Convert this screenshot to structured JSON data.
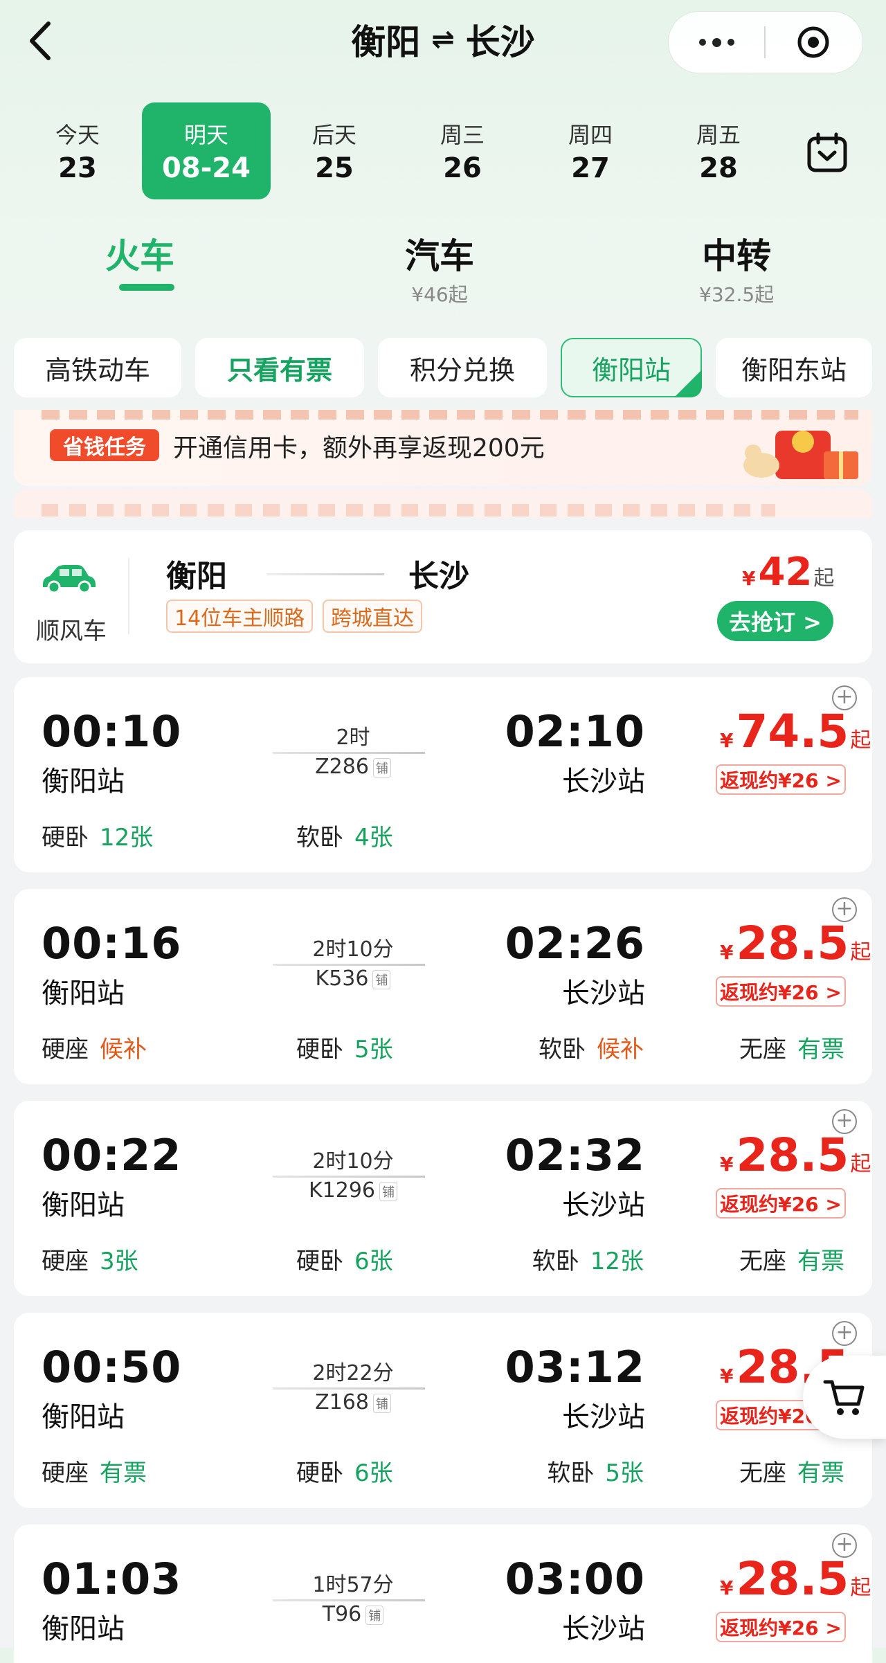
{
  "header": {
    "from_city": "衡阳",
    "swap_icon": "⇌",
    "to_city": "长沙"
  },
  "dates": [
    {
      "week": "今天",
      "day": "23"
    },
    {
      "week": "明天",
      "day": "08-24"
    },
    {
      "week": "后天",
      "day": "25"
    },
    {
      "week": "周三",
      "day": "26"
    },
    {
      "week": "周四",
      "day": "27"
    },
    {
      "week": "周五",
      "day": "28"
    }
  ],
  "modes": [
    {
      "label": "火车",
      "sub": ""
    },
    {
      "label": "汽车",
      "sub": "¥46起"
    },
    {
      "label": "中转",
      "sub": "¥32.5起"
    }
  ],
  "filters": [
    "高铁动车",
    "只看有票",
    "积分兑换",
    "衡阳站",
    "衡阳东站"
  ],
  "promo": {
    "badge": "省钱任务",
    "text": "开通信用卡，额外再享返现200元"
  },
  "carpool": {
    "label": "顺风车",
    "from": "衡阳",
    "to": "长沙",
    "tags": [
      "14位车主顺路",
      "跨城直达"
    ],
    "currency": "¥",
    "price": "42",
    "price_suffix": "起",
    "button": "去抢订 >"
  },
  "trains": [
    {
      "dep_time": "00:10",
      "dep_station": "衡阳站",
      "arr_time": "02:10",
      "arr_station": "长沙站",
      "duration": "2时",
      "train_no": "Z286",
      "berth_tag": "铺",
      "currency": "¥",
      "price": "74.5",
      "price_suffix": "起",
      "cashback": "返现约¥26 >",
      "seats": [
        {
          "name": "硬卧",
          "value": "12张"
        },
        {
          "name": "软卧",
          "value": "4张"
        }
      ]
    },
    {
      "dep_time": "00:16",
      "dep_station": "衡阳站",
      "arr_time": "02:26",
      "arr_station": "长沙站",
      "duration": "2时10分",
      "train_no": "K536",
      "berth_tag": "铺",
      "currency": "¥",
      "price": "28.5",
      "price_suffix": "起",
      "cashback": "返现约¥26 >",
      "seats": [
        {
          "name": "硬座",
          "value": "候补"
        },
        {
          "name": "硬卧",
          "value": "5张"
        },
        {
          "name": "软卧",
          "value": "候补"
        },
        {
          "name": "无座",
          "value": "有票"
        }
      ]
    },
    {
      "dep_time": "00:22",
      "dep_station": "衡阳站",
      "arr_time": "02:32",
      "arr_station": "长沙站",
      "duration": "2时10分",
      "train_no": "K1296",
      "berth_tag": "铺",
      "currency": "¥",
      "price": "28.5",
      "price_suffix": "起",
      "cashback": "返现约¥26 >",
      "seats": [
        {
          "name": "硬座",
          "value": "3张"
        },
        {
          "name": "硬卧",
          "value": "6张"
        },
        {
          "name": "软卧",
          "value": "12张"
        },
        {
          "name": "无座",
          "value": "有票"
        }
      ]
    },
    {
      "dep_time": "00:50",
      "dep_station": "衡阳站",
      "arr_time": "03:12",
      "arr_station": "长沙站",
      "duration": "2时22分",
      "train_no": "Z168",
      "berth_tag": "铺",
      "currency": "¥",
      "price": "28.5",
      "price_suffix": "起",
      "cashback": "返现约¥26 >",
      "seats": [
        {
          "name": "硬座",
          "value": "有票"
        },
        {
          "name": "硬卧",
          "value": "6张"
        },
        {
          "name": "软卧",
          "value": "5张"
        },
        {
          "name": "无座",
          "value": "有票"
        }
      ]
    },
    {
      "dep_time": "01:03",
      "dep_station": "衡阳站",
      "arr_time": "03:00",
      "arr_station": "长沙站",
      "duration": "1时57分",
      "train_no": "T96",
      "berth_tag": "铺",
      "currency": "¥",
      "price": "28.5",
      "price_suffix": "起",
      "cashback": "返现约¥26 >",
      "seats": []
    }
  ],
  "icons": {
    "back": "back-arrow-icon",
    "more": "more-dots-icon",
    "target": "target-circle-icon",
    "calendar": "calendar-icon",
    "car": "car-icon",
    "plus": "plus-circle-icon",
    "cart": "cart-icon"
  },
  "colors": {
    "accent_green": "#1fb46a",
    "price_red": "#e9241b",
    "waitlist_orange": "#e05a1b"
  }
}
